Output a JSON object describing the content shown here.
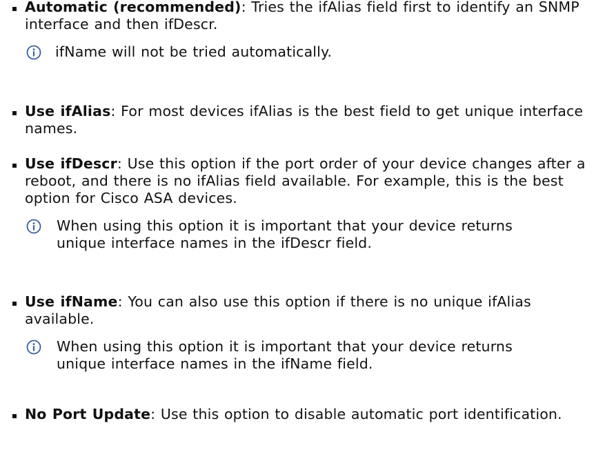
{
  "options": [
    {
      "term": "Automatic (recommended)",
      "desc": ": Tries the ifAlias field first to identify an SNMP interface and then ifDescr.",
      "note": "ifName will not be tried automatically."
    },
    {
      "term": "Use ifAlias",
      "desc": ": For most devices ifAlias is the best field to get unique interface names."
    },
    {
      "term": "Use ifDescr",
      "desc": ": Use this option if the port order of your device changes after a reboot, and there is no ifAlias field available. For example, this is the best option for Cisco ASA devices.",
      "note": "When using this option it is important that your device returns unique interface names in the ifDescr field."
    },
    {
      "term": "Use ifName",
      "desc": ": You can also use this option if there is no unique ifAlias available.",
      "note": "When using this option it is important that your device returns unique interface names in the ifName field."
    },
    {
      "term": "No Port Update",
      "desc": ": Use this option to disable automatic port identification."
    }
  ],
  "info_icon": "info-circle-icon",
  "colors": {
    "text": "#111111",
    "info_icon": "#3a5fa0"
  }
}
